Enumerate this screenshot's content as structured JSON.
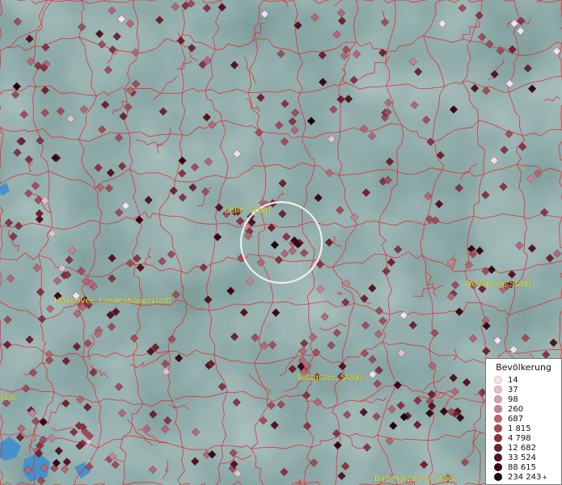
{
  "map": {
    "cities": [
      {
        "label": "Celle, Stadt"
      },
      {
        "label": "Hannover, Landeshauptstadt"
      },
      {
        "label": "Wolfsburg, Stadt"
      },
      {
        "label": "Salzgitter, Stadt"
      },
      {
        "label": "Bad Harzburg, Stadt"
      },
      {
        "label": "tadt"
      }
    ],
    "selection_circle": "highlight-circle"
  },
  "legend": {
    "title": "Bevölkerung",
    "entries": [
      {
        "label": "14",
        "color": "#f6e0ea"
      },
      {
        "label": "37",
        "color": "#e7c0cc"
      },
      {
        "label": "98",
        "color": "#d7a1ae"
      },
      {
        "label": "260",
        "color": "#c78390"
      },
      {
        "label": "687",
        "color": "#b76674"
      },
      {
        "label": "1 815",
        "color": "#a34c5a"
      },
      {
        "label": "4 798",
        "color": "#8c3443"
      },
      {
        "label": "12 682",
        "color": "#742231"
      },
      {
        "label": "33 524",
        "color": "#5a1320"
      },
      {
        "label": "88 615",
        "color": "#3e0813"
      },
      {
        "label": "234 243",
        "color": "#220208",
        "suffix": "+"
      }
    ]
  },
  "colors": {
    "map_background": "#7e9f9d",
    "borders": "#e8232b",
    "water": "#3f8fcf",
    "label": "#e8e84a"
  }
}
